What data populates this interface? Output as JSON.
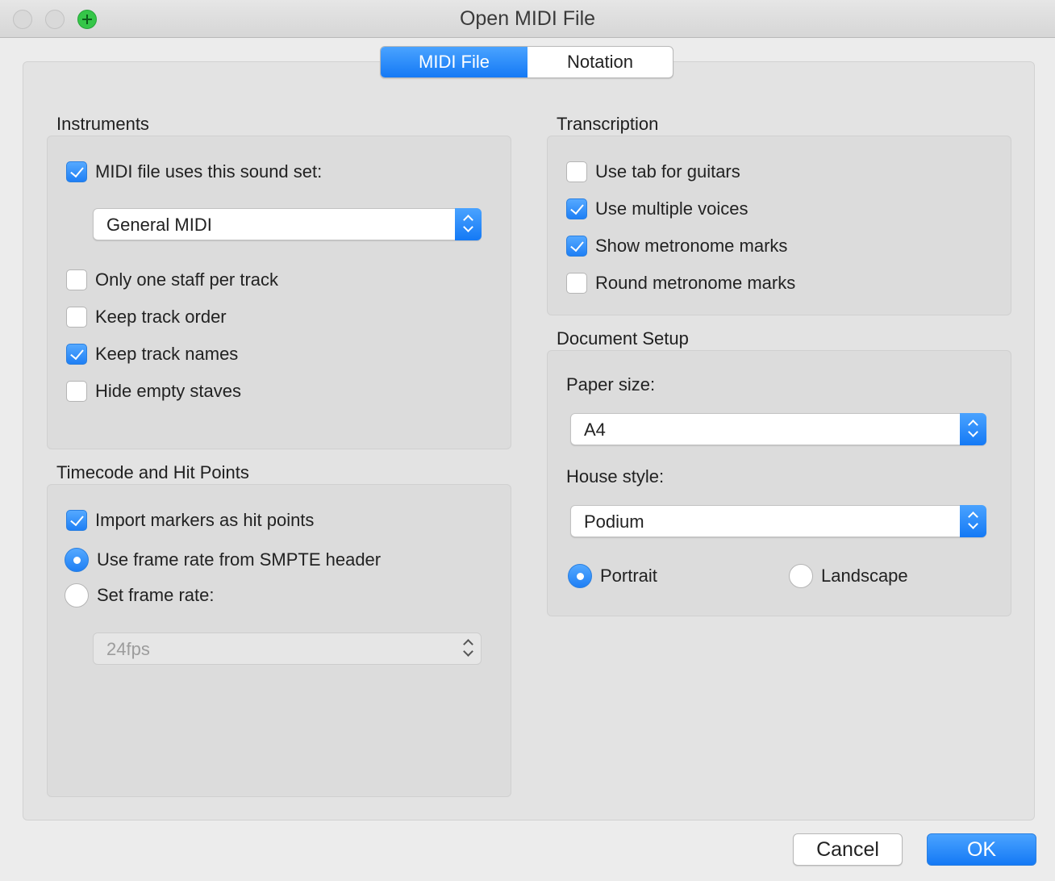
{
  "window": {
    "title": "Open MIDI File"
  },
  "tabs": [
    {
      "label": "MIDI File",
      "active": true
    },
    {
      "label": "Notation",
      "active": false
    }
  ],
  "instruments": {
    "title": "Instruments",
    "sound_set_label": "MIDI file uses this sound set:",
    "sound_set_checked": true,
    "sound_set_value": "General MIDI",
    "options": [
      {
        "label": "Only one staff per track",
        "checked": false
      },
      {
        "label": "Keep track order",
        "checked": false
      },
      {
        "label": "Keep track names",
        "checked": true
      },
      {
        "label": "Hide empty staves",
        "checked": false
      }
    ]
  },
  "timecode": {
    "title": "Timecode and Hit Points",
    "import_markers_label": "Import markers as hit points",
    "import_markers_checked": true,
    "radios": [
      {
        "label": "Use frame rate from SMPTE header",
        "checked": true
      },
      {
        "label": "Set frame rate:",
        "checked": false
      }
    ],
    "frame_rate_value": "24fps",
    "frame_rate_disabled": true
  },
  "transcription": {
    "title": "Transcription",
    "options": [
      {
        "label": "Use tab for guitars",
        "checked": false
      },
      {
        "label": "Use multiple voices",
        "checked": true
      },
      {
        "label": "Show metronome marks",
        "checked": true
      },
      {
        "label": "Round metronome marks",
        "checked": false
      }
    ]
  },
  "document_setup": {
    "title": "Document Setup",
    "paper_size_label": "Paper size:",
    "paper_size_value": "A4",
    "house_style_label": "House style:",
    "house_style_value": "Podium",
    "orientation": [
      {
        "label": "Portrait",
        "checked": true
      },
      {
        "label": "Landscape",
        "checked": false
      }
    ]
  },
  "buttons": {
    "cancel": "Cancel",
    "ok": "OK"
  },
  "colors": {
    "accent": "#1e7ff5",
    "background": "#ececec",
    "group": "#dcdcdc"
  }
}
